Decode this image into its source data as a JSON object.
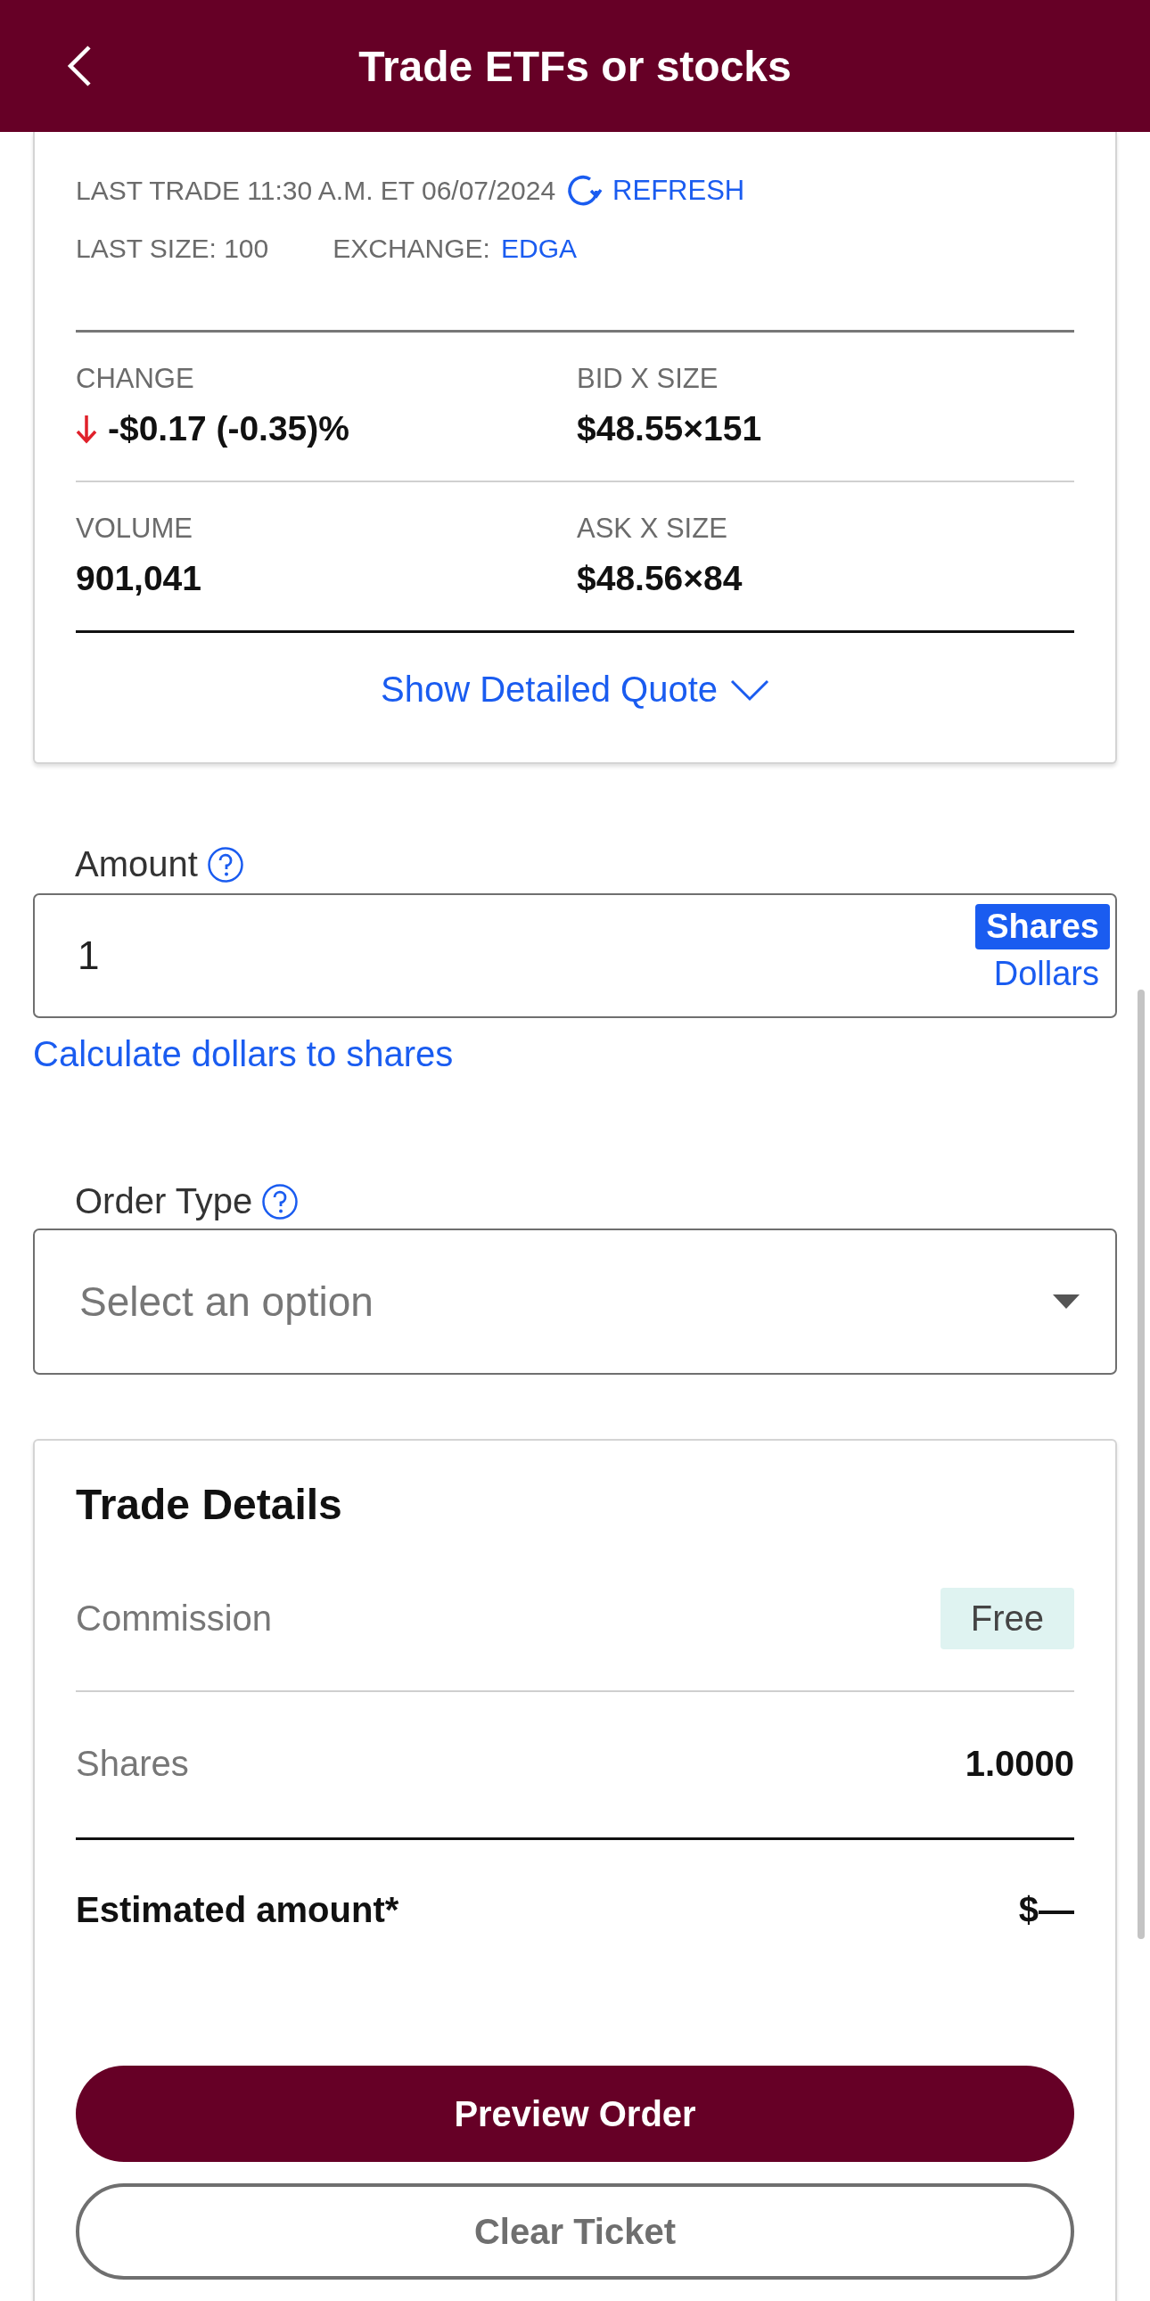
{
  "header": {
    "title": "Trade ETFs or stocks"
  },
  "quote": {
    "last_trade": "LAST TRADE 11:30 A.M. ET 06/07/2024",
    "refresh": "REFRESH",
    "last_size": "LAST SIZE: 100",
    "exchange_label": "EXCHANGE:",
    "exchange": "EDGA",
    "stats": [
      {
        "label": "CHANGE",
        "value": "-$0.17 (-0.35)%",
        "falling": true
      },
      {
        "label": "BID X SIZE",
        "value": "$48.55×151",
        "falling": false
      },
      {
        "label": "VOLUME",
        "value": "901,041",
        "falling": false
      },
      {
        "label": "ASK X SIZE",
        "value": "$48.56×84",
        "falling": false
      }
    ],
    "detail_link": "Show Detailed Quote"
  },
  "amount": {
    "label": "Amount",
    "value": "1",
    "units": [
      {
        "label": "Shares",
        "selected": true
      },
      {
        "label": "Dollars",
        "selected": false
      }
    ],
    "calc_link": "Calculate dollars to shares"
  },
  "order_type": {
    "label": "Order Type",
    "placeholder": "Select an option"
  },
  "trade_details": {
    "title": "Trade Details",
    "rows": [
      {
        "label": "Commission",
        "value": "Free",
        "kind": "badge"
      },
      {
        "label": "Shares",
        "value": "1.0000",
        "kind": "plain"
      },
      {
        "label": "Estimated amount*",
        "value": "$—",
        "kind": "total"
      }
    ]
  },
  "buttons": [
    {
      "label": "Preview Order",
      "kind": "primary"
    },
    {
      "label": "Clear Ticket",
      "kind": "secondary"
    }
  ]
}
